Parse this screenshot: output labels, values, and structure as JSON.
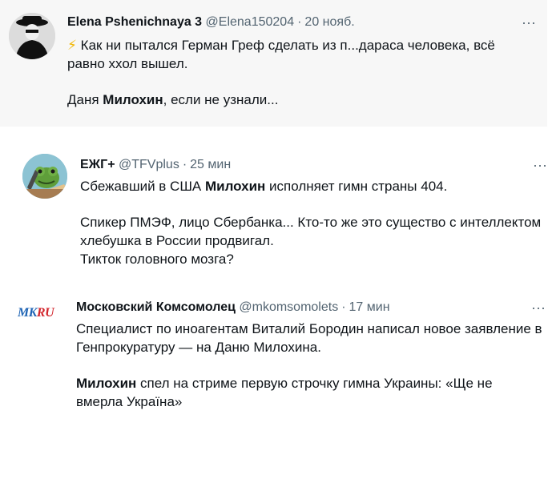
{
  "tweets": [
    {
      "name": "Elena Pshenichnaya 3",
      "handle": "@Elena150204",
      "dot": "·",
      "time": "20 нояб.",
      "more": "···",
      "bolt": "⚡",
      "line1": "Как ни пытался Герман Греф сделать из п...дараса человека, всё",
      "line2": "равно ххол вышел.",
      "line3_pre": "Даня ",
      "line3_bold": "Милохин",
      "line3_post": ", если не узнали..."
    },
    {
      "name": "ЕЖГ+",
      "handle": "@TFVplus",
      "dot": "·",
      "time": "25 мин",
      "more": "···",
      "line1_pre": "Сбежавший в США ",
      "line1_bold": "Милохин",
      "line1_post": " исполняет гимн страны 404.",
      "line2": "Спикер ПМЭФ, лицо Сбербанка... Кто-то же это существо с интеллектом",
      "line3": "хлебушка в России продвигал.",
      "line4": "Тикток головного мозга?"
    },
    {
      "name": "Московский Комсомолец",
      "handle": "@mkomsomolets",
      "dot": "·",
      "time": "17 мин",
      "more": "···",
      "logo_mk": "MK",
      "logo_ru": "RU",
      "line1": "Специалист по иноагентам Виталий Бородин написал новое заявление в",
      "line2": "Генпрокуратуру — на Даню Милохина.",
      "line3_bold": "Милохин",
      "line3_post": " спел на стриме первую строчку гимна Украины: «Ще не",
      "line4": "вмерла Україна»"
    }
  ]
}
